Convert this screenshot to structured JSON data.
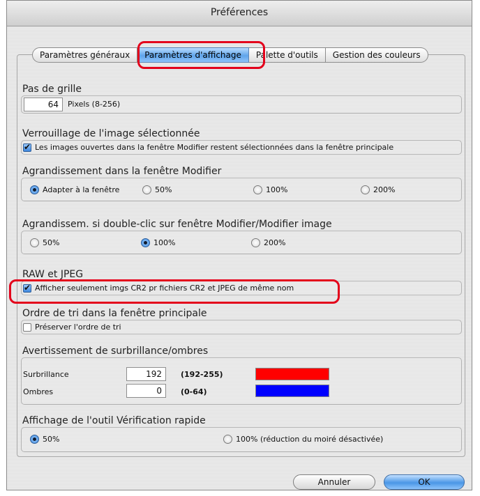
{
  "window": {
    "title": "Préférences"
  },
  "tabs": [
    {
      "label": "Paramètres généraux",
      "selected": false
    },
    {
      "label": "Paramètres d'affichage",
      "selected": true
    },
    {
      "label": "Palette d'outils",
      "selected": false
    },
    {
      "label": "Gestion des couleurs",
      "selected": false
    }
  ],
  "grid": {
    "title": "Pas de grille",
    "value": "64",
    "unit": "Pixels (8-256)"
  },
  "lock": {
    "title": "Verrouillage de l'image sélectionnée",
    "checkbox_label": "Les images ouvertes dans la fenêtre Modifier restent sélectionnées dans la fenêtre principale",
    "checked": true
  },
  "enlarge": {
    "title": "Agrandissement dans la fenêtre Modifier",
    "options": [
      "Adapter à la fenêtre",
      "50%",
      "100%",
      "200%"
    ],
    "selected": "Adapter à la fenêtre"
  },
  "dblclick": {
    "title": "Agrandissem. si double-clic sur fenêtre Modifier/Modifier image",
    "options": [
      "50%",
      "100%",
      "200%"
    ],
    "selected": "100%"
  },
  "raw": {
    "title": "RAW et JPEG",
    "checkbox_label": "Afficher seulement imgs CR2 pr fichiers CR2 et JPEG de même nom",
    "checked": true
  },
  "sort": {
    "title": "Ordre de tri dans la fenêtre principale",
    "checkbox_label": "Préserver l'ordre de tri",
    "checked": false
  },
  "warning": {
    "title": "Avertissement de surbrillance/ombres",
    "highlight_label": "Surbrillance",
    "highlight_value": "192",
    "highlight_range": "(192-255)",
    "highlight_color": "#ff0000",
    "shadow_label": "Ombres",
    "shadow_value": "0",
    "shadow_range": "(0-64)",
    "shadow_color": "#0000ff"
  },
  "quickcheck": {
    "title": "Affichage de l'outil Vérification rapide",
    "options": [
      "50%",
      "100% (réduction du moiré désactivée)"
    ],
    "selected": "50%"
  },
  "buttons": {
    "cancel": "Annuler",
    "ok": "OK"
  },
  "colors": {
    "annotation": "#e3001b",
    "accent": "#4a96e6"
  }
}
